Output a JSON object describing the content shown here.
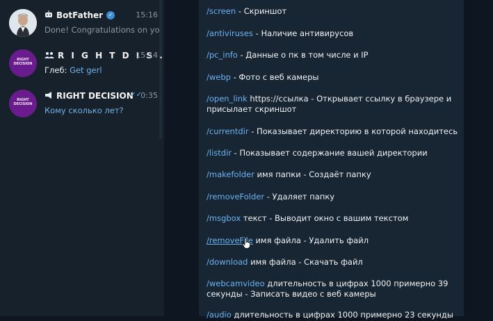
{
  "chats": [
    {
      "name": "BotFather",
      "time": "15:16",
      "preview": "Done! Congratulations on yo...",
      "type_icon": "bot-icon",
      "verified": true
    },
    {
      "name": "R I G H T  D I S ...",
      "time": "15:14",
      "sender": "Глеб:",
      "preview": "Get gerl",
      "type_icon": "group-icon",
      "avatar_text": "RIGHT DECISION"
    },
    {
      "name": "RIGHT DECISION",
      "time": "0:35",
      "preview": "Кому сколько лет?",
      "type_icon": "channel-icon",
      "read_status": "double-check",
      "avatar_text": "RIGHT DECISION"
    }
  ],
  "commands": [
    {
      "cmd": "/screen",
      "desc": " - Скриншот"
    },
    {
      "cmd": "/antiviruses",
      "desc": " - Наличие антивирусов"
    },
    {
      "cmd": "/pc_info",
      "desc": " - Данные о пк в том числе и IP"
    },
    {
      "cmd": "/webp",
      "desc": " - Фото с веб камеры"
    },
    {
      "cmd": "/open_link",
      "desc": " https://ссылка - Открывает ссылку в браузере и",
      "desc2": "присылает скриншот"
    },
    {
      "cmd": "/currentdir",
      "desc": " - Показывает директорию в которой находитесь"
    },
    {
      "cmd": "/listdir",
      "desc": " - Показывает содержание вашей директории"
    },
    {
      "cmd": "/makefolder",
      "desc": " имя папки - Создаёт папку"
    },
    {
      "cmd": "/removeFolder",
      "desc": " - Удаляет папку"
    },
    {
      "cmd": "/msgbox",
      "desc": " текст - Выводит окно с вашим текстом"
    },
    {
      "cmd": "/removeFile",
      "desc": " имя файла - Удалить файл"
    },
    {
      "cmd": "/download",
      "desc": " имя файла - Скачать файл"
    },
    {
      "cmd": "/webcamvideo",
      "desc": " длительность в цифрах 1000 примерно 39",
      "desc2": "секунды - Записать видео с веб камеры"
    },
    {
      "cmd": "/audio",
      "desc": " длительность в цифрах 1000 примерно 23 секунды"
    }
  ]
}
